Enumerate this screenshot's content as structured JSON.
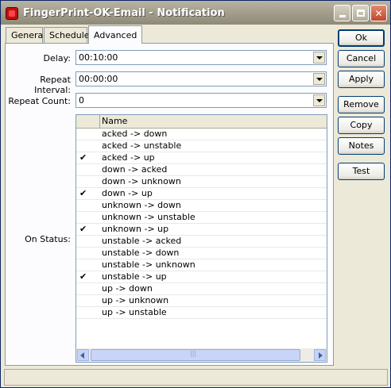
{
  "window": {
    "title": "FingerPrint-OK-Email - Notification"
  },
  "tabs": [
    {
      "label": "General",
      "active": false
    },
    {
      "label": "Schedule",
      "active": false
    },
    {
      "label": "Advanced",
      "active": true
    }
  ],
  "fields": {
    "delay": {
      "label": "Delay:",
      "value": "00:10:00"
    },
    "repeat_interval": {
      "label": "Repeat Interval:",
      "value": "00:00:00"
    },
    "repeat_count": {
      "label": "Repeat Count:",
      "value": "0"
    }
  },
  "on_status": {
    "label": "On Status:",
    "column_header": "Name",
    "items": [
      {
        "name": "acked -> down",
        "checked": false
      },
      {
        "name": "acked -> unstable",
        "checked": false
      },
      {
        "name": "acked -> up",
        "checked": true
      },
      {
        "name": "down -> acked",
        "checked": false
      },
      {
        "name": "down -> unknown",
        "checked": false
      },
      {
        "name": "down -> up",
        "checked": true
      },
      {
        "name": "unknown -> down",
        "checked": false
      },
      {
        "name": "unknown -> unstable",
        "checked": false
      },
      {
        "name": "unknown -> up",
        "checked": true
      },
      {
        "name": "unstable -> acked",
        "checked": false
      },
      {
        "name": "unstable -> down",
        "checked": false
      },
      {
        "name": "unstable -> unknown",
        "checked": false
      },
      {
        "name": "unstable -> up",
        "checked": true
      },
      {
        "name": "up -> down",
        "checked": false
      },
      {
        "name": "up -> unknown",
        "checked": false
      },
      {
        "name": "up -> unstable",
        "checked": false
      }
    ]
  },
  "buttons": {
    "ok": "Ok",
    "cancel": "Cancel",
    "apply": "Apply",
    "remove": "Remove",
    "copy": "Copy",
    "notes": "Notes",
    "test": "Test"
  },
  "colors": {
    "titlebar": "#9f9a87",
    "window_bg": "#ece9d8",
    "panel_bg": "#fcfcfe"
  }
}
